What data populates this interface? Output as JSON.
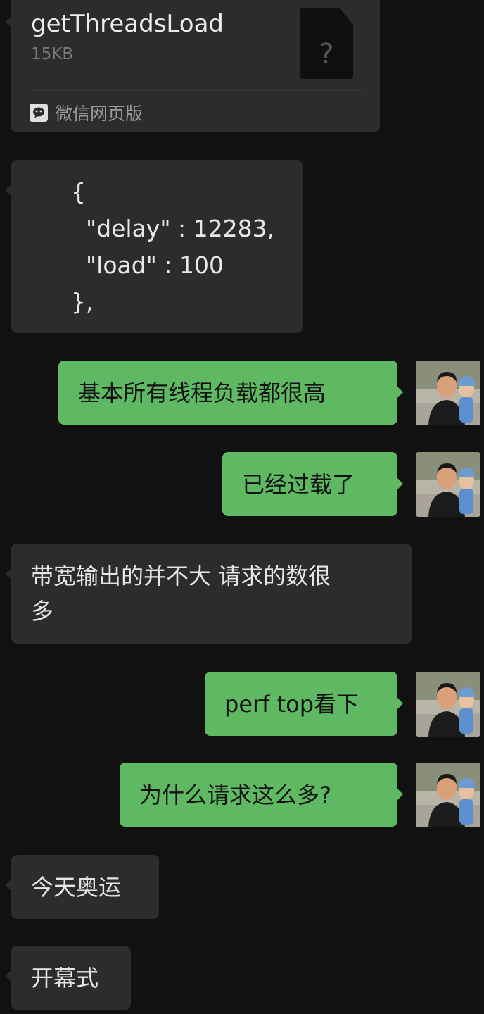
{
  "file_message": {
    "name": "getThreadsLoad",
    "size": "15KB",
    "icon_glyph": "?",
    "source": "微信网页版",
    "source_icon": "wechat-icon"
  },
  "json_message": {
    "lines": [
      "{",
      "  \"delay\" : 12283,",
      "  \"load\" : 100",
      "},"
    ]
  },
  "messages": [
    {
      "side": "out",
      "text": "基本所有线程负载都很高"
    },
    {
      "side": "out",
      "text": "已经过载了"
    },
    {
      "side": "in",
      "line1": "带宽输出的并不大 请求的数很",
      "line2": "多"
    },
    {
      "side": "out",
      "text": "perf top看下"
    },
    {
      "side": "out",
      "text": "为什么请求这么多?"
    },
    {
      "side": "in",
      "text": "今天奥运"
    },
    {
      "side": "in",
      "text": "开幕式"
    }
  ],
  "colors": {
    "background": "#111111",
    "incoming_bubble": "#2c2c2c",
    "outgoing_bubble": "#5fb862"
  }
}
